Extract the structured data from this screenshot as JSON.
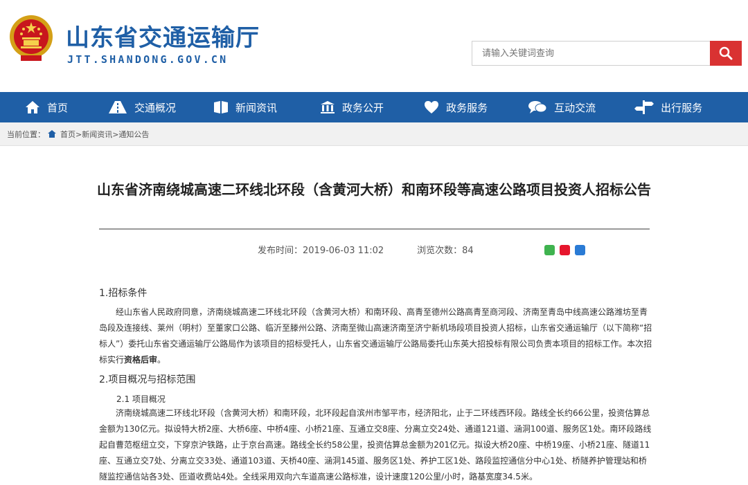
{
  "header": {
    "site_title": "山东省交通运输厅",
    "site_domain": "JTT.SHANDONG.GOV.CN",
    "search_placeholder": "请输入关键词查询"
  },
  "nav": {
    "items": [
      {
        "label": "首页",
        "icon": "home-icon"
      },
      {
        "label": "交通概况",
        "icon": "road-icon"
      },
      {
        "label": "新闻资讯",
        "icon": "book-icon"
      },
      {
        "label": "政务公开",
        "icon": "building-icon"
      },
      {
        "label": "政务服务",
        "icon": "heart-icon"
      },
      {
        "label": "互动交流",
        "icon": "chat-icon"
      },
      {
        "label": "出行服务",
        "icon": "signpost-icon"
      }
    ]
  },
  "breadcrumb": {
    "prefix": "当前位置：",
    "path": "首页>新闻资讯>通知公告"
  },
  "article": {
    "title": "山东省济南绕城高速二环线北环段（含黄河大桥）和南环段等高速公路项目投资人招标公告",
    "publish_time": "发布时间：2019-06-03 11:02",
    "views": "浏览次数：84",
    "sections": {
      "s1_heading": "1.招标条件",
      "s1_para_main": "经山东省人民政府同意，济南绕城高速二环线北环段（含黄河大桥）和南环段、高青至德州公路高青至商河段、济南至青岛中线高速公路潍坊至青岛段及连接线、莱州（明村）至董家口公路、临沂至滕州公路、济南至微山高速济南至济宁新机场段项目投资人招标，山东省交通运输厅（以下简称“招标人”）委托山东省交通运输厅公路局作为该项目的招标受托人，山东省交通运输厅公路局委托山东英大招投标有限公司负责本项目的招标工作。本次招标实行",
      "s1_para_bold": "资格后审",
      "s1_para_end": "。",
      "s2_heading": "2.项目概况与招标范围",
      "s21_heading": "2.1 项目概况",
      "s21_para": "济南绕城高速二环线北环段（含黄河大桥）和南环段，北环段起自滨州市邹平市，经济阳北，止于二环线西环段。路线全长约66公里，投资估算总金额为130亿元。拟设特大桥2座、大桥6座、中桥4座、小桥21座、互通立交8座、分离立交24处、通道121道、涵洞100道、服务区1处。南环段路线起自曹范枢纽立交，下穿京沪铁路，止于京台高速。路线全长约58公里，投资估算总金额为201亿元。拟设大桥20座、中桥19座、小桥21座、隧道11座、互通立交7处、分离立交33处、通道103道、天桥40座、涵洞145道、服务区1处、养护工区1处、路段监控通信分中心1处、桥隧养护管理站和桥隧监控通信站各3处、匝道收费站4处。全线采用双向六车道高速公路标准，设计速度120公里/小时，路基宽度34.5米。"
    }
  },
  "colors": {
    "brand_blue": "#1f5fa6",
    "search_red": "#d93232"
  }
}
